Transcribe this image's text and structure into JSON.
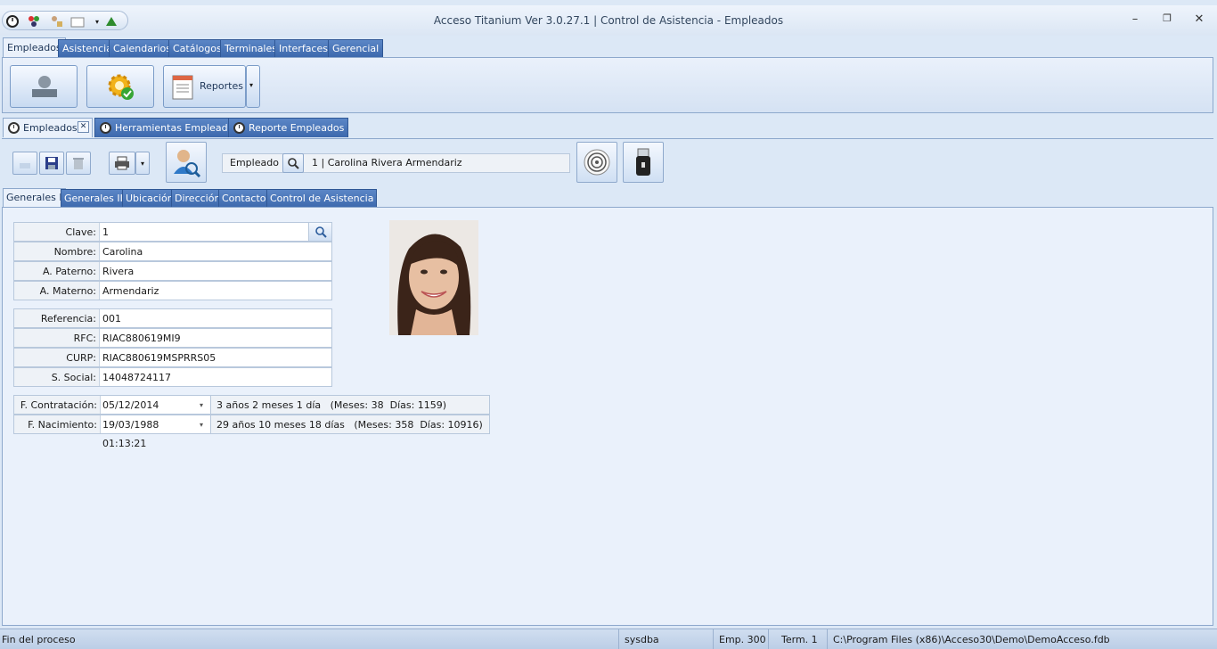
{
  "window": {
    "title": "Acceso Titanium  Ver 3.0.27.1 | Control de Asistencia - Empleados",
    "minimize": "–",
    "restore": "❐",
    "close": "✕"
  },
  "ribbon": {
    "tabs": [
      "Empleados",
      "Asistencia",
      "Calendarios",
      "Catálogos",
      "Terminales",
      "Interfaces",
      "Gerencial"
    ],
    "reportes_label": "Reportes"
  },
  "doc_tabs": [
    "Empleados",
    "Herramientas Empleados",
    "Reporte Empleados"
  ],
  "toolbar": {
    "empleado_label": "Empleado",
    "empleado_value": "1 | Carolina Rivera Armendariz"
  },
  "inner_tabs": [
    "Generales I",
    "Generales II",
    "Ubicación",
    "Dirección",
    "Contacto",
    "Control de Asistencia"
  ],
  "form": {
    "group1": [
      {
        "label": "Clave:",
        "value": "1"
      },
      {
        "label": "Nombre:",
        "value": "Carolina"
      },
      {
        "label": "A. Paterno:",
        "value": "Rivera"
      },
      {
        "label": "A. Materno:",
        "value": "Armendariz"
      }
    ],
    "group2": [
      {
        "label": "Referencia:",
        "value": "001"
      },
      {
        "label": "RFC:",
        "value": "RIAC880619MI9"
      },
      {
        "label": "CURP:",
        "value": "RIAC880619MSPRRS05"
      },
      {
        "label": "S. Social:",
        "value": "14048724117"
      }
    ],
    "dates": [
      {
        "label": "F. Contratación:",
        "value": "05/12/2014 01:13:21",
        "info": "3 años 2 meses 1 día   (Meses: 38  Días: 1159)"
      },
      {
        "label": "F. Nacimiento:",
        "value": "19/03/1988 01:13:21",
        "info": "29 años 10 meses 18 días   (Meses: 358  Días: 10916)"
      }
    ]
  },
  "status": {
    "message": "Fin del proceso",
    "user": "sysdba",
    "emp": "Emp. 300",
    "term": "Term. 1",
    "path": "C:\\Program Files (x86)\\Acceso30\\Demo\\DemoAcceso.fdb"
  },
  "colors": {
    "accent": "#3d69ad",
    "background": "#dce8f6",
    "panel": "#eaf1fb"
  }
}
